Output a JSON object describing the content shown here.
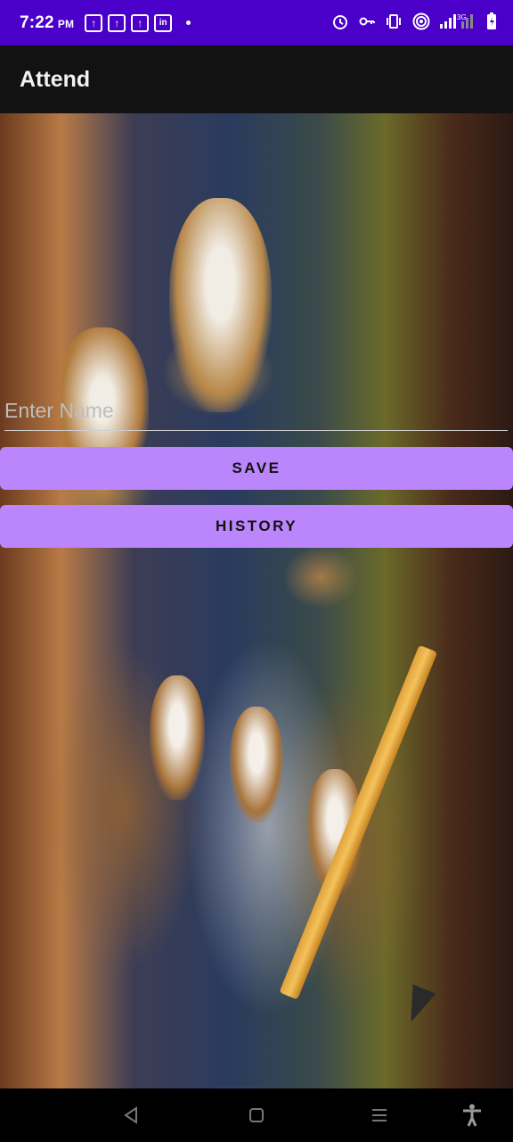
{
  "status_bar": {
    "time": "7:22",
    "ampm": "PM",
    "notification_icons": [
      "notification-icon",
      "notification-icon",
      "notification-icon",
      "linkedin-icon"
    ],
    "system_icons": [
      "alarm-icon",
      "vpn-key-icon",
      "vibrate-icon",
      "hotspot-icon",
      "signal-icon",
      "battery-icon"
    ],
    "network_label": "3G"
  },
  "app_bar": {
    "title": "Attend"
  },
  "form": {
    "name_placeholder": "Enter Name",
    "name_value": "",
    "save_label": "SAVE",
    "history_label": "HISTORY"
  },
  "nav_bar": {
    "buttons": [
      "back-icon",
      "home-icon",
      "recents-icon",
      "accessibility-icon"
    ]
  },
  "colors": {
    "status_bar": "#4a00c8",
    "app_bar": "#121212",
    "button": "#bb86fc",
    "button_text": "#111111"
  }
}
